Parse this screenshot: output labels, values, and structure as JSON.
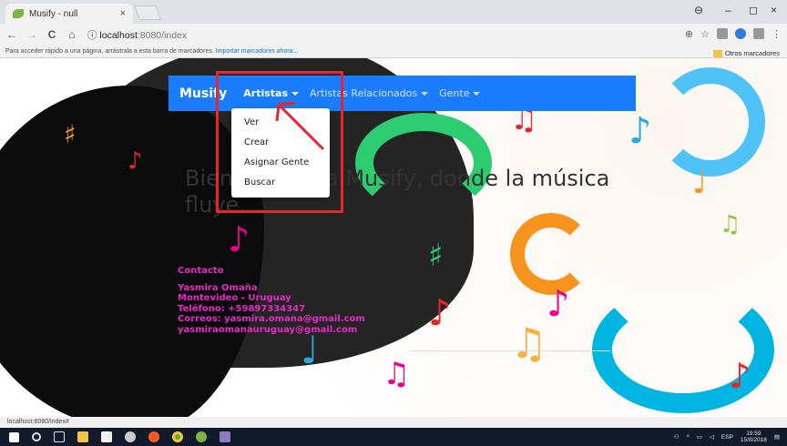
{
  "browser": {
    "tab_title": "Musify - null",
    "tab_close": "×",
    "back_glyph": "←",
    "forward_glyph": "→",
    "reload_glyph": "C",
    "home_glyph": "⌂",
    "info_glyph": "ⓘ",
    "url_host": "localhost",
    "url_path": ":8080/index",
    "window_minimize": "–",
    "window_maximize": "◻",
    "window_close": "×",
    "zoom_glyph": "⊕",
    "star_glyph": "☆",
    "menu_glyph": "⋮",
    "bookmarks_hint": "Para acceder rápido a una página, arrástrala a esta barra de marcadores.",
    "bookmarks_import": "Importar marcadores ahora...",
    "other_bookmarks": "Otros marcadores",
    "status_url": "localhost:8080/index#"
  },
  "navbar": {
    "brand": "Musify",
    "items": [
      {
        "label": "Artistas",
        "active": true
      },
      {
        "label": "Artistas Relacionados",
        "active": false
      },
      {
        "label": "Gente",
        "active": false
      }
    ],
    "accent": "#1a7cff"
  },
  "dropdown": {
    "items": [
      "Ver",
      "Crear",
      "Asignar Gente",
      "Buscar"
    ]
  },
  "hero": {
    "text": "Bienvenidos a Musify, donde la música fluye."
  },
  "contact": {
    "heading": "Contacto",
    "lines": [
      "Yasmira Omaña",
      "Montevideo - Uruguay",
      "Teléfono: +59897334347",
      "Correos: yasmira.omana@gmail.com",
      "yasmiraomanauruguay@gmail.com"
    ],
    "color": "#e829c8"
  },
  "taskbar": {
    "lang": "ESP",
    "time": "19:59",
    "date": "15/8/2018"
  },
  "annotation": {
    "color": "#e8242c"
  }
}
